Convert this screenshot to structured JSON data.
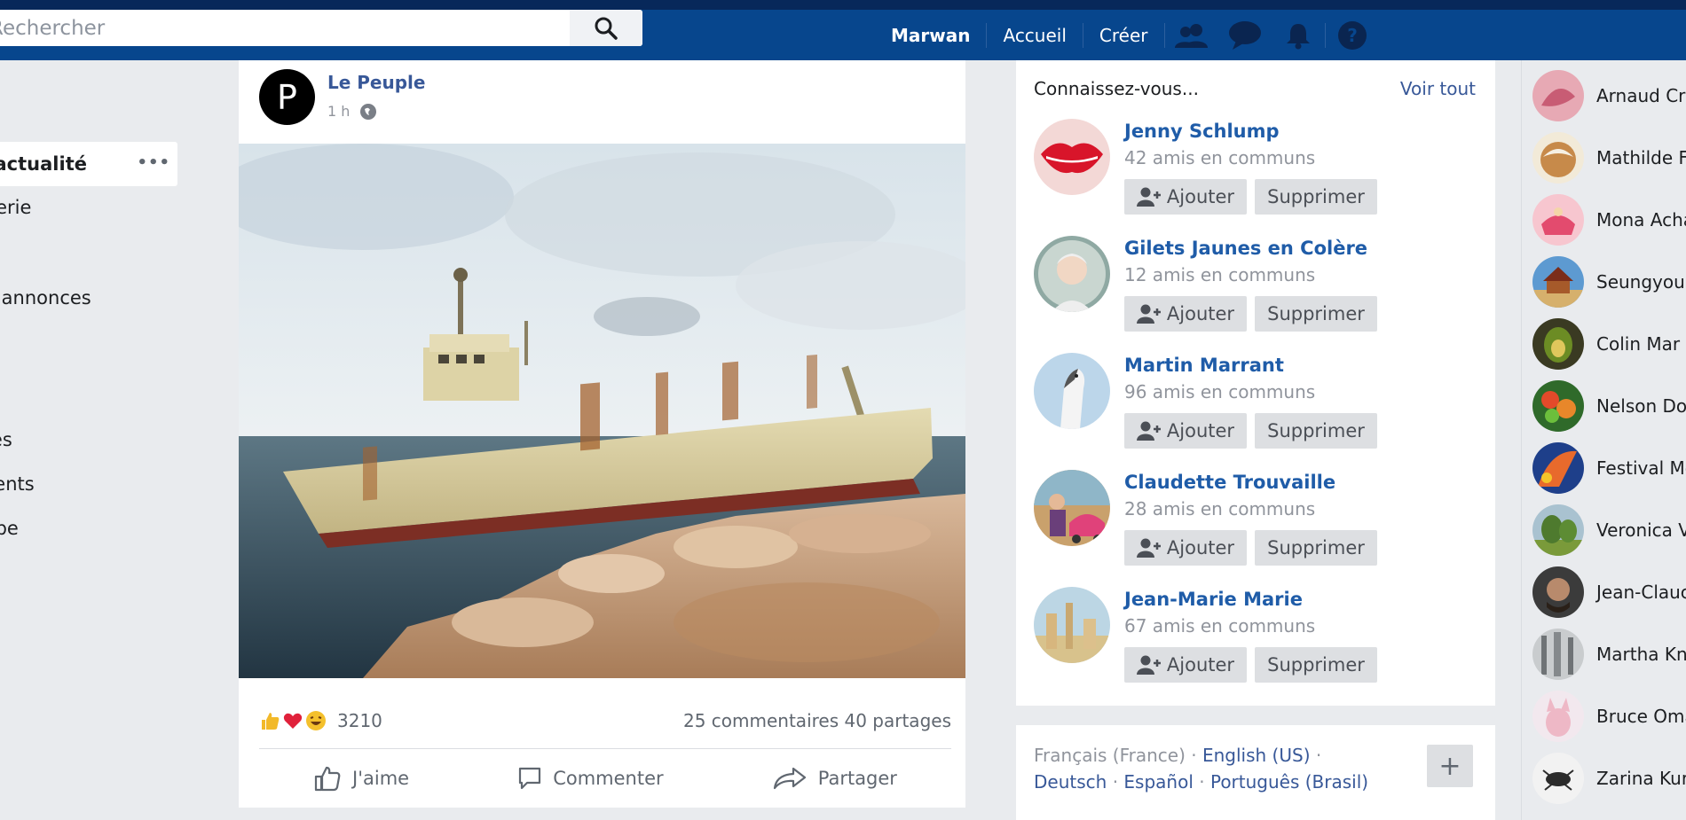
{
  "search": {
    "placeholder": "Rechercher"
  },
  "topnav": {
    "user": "Marwan",
    "home": "Accueil",
    "create": "Créer"
  },
  "left_nav": {
    "items": [
      {
        "label": "Fil d'actualité",
        "active": true
      },
      {
        "label": "Messagerie"
      },
      {
        "label": "Petites annonces"
      },
      {
        "label": "Pages"
      },
      {
        "label": "Événements"
      },
      {
        "label": "Groupe"
      }
    ]
  },
  "post": {
    "avatar_letter": "P",
    "author": "Le Peuple",
    "time": "1 h",
    "reaction_count": "3210",
    "comments_shares": "25 commentaires 40 partages",
    "actions": {
      "like": "J'aime",
      "comment": "Commenter",
      "share": "Partager"
    }
  },
  "suggestions": {
    "title": "Connaissez-vous...",
    "see_all": "Voir tout",
    "add_label": "Ajouter",
    "remove_label": "Supprimer",
    "people": [
      {
        "name": "Jenny Schlump",
        "mutual": "42 amis en communs"
      },
      {
        "name": "Gilets Jaunes en Colère",
        "mutual": "12 amis en communs"
      },
      {
        "name": "Martin Marrant",
        "mutual": "96 amis en communs"
      },
      {
        "name": "Claudette Trouvaille",
        "mutual": "28 amis en communs"
      },
      {
        "name": "Jean-Marie Marie",
        "mutual": "67 amis en communs"
      }
    ]
  },
  "languages": {
    "current": "Français (France)",
    "english": "English (US)",
    "german": "Deutsch",
    "spanish": "Español",
    "portuguese": "Português (Brasil)",
    "more": "+"
  },
  "contacts": [
    {
      "name": "Arnaud Cra"
    },
    {
      "name": "Mathilde F"
    },
    {
      "name": "Mona Acha"
    },
    {
      "name": "Seungyou"
    },
    {
      "name": "Colin Mar"
    },
    {
      "name": "Nelson Do"
    },
    {
      "name": "Festival Mo"
    },
    {
      "name": "Veronica V"
    },
    {
      "name": "Jean-Clauc"
    },
    {
      "name": "Martha Kn"
    },
    {
      "name": "Bruce Oma"
    },
    {
      "name": "Zarina Kur"
    }
  ]
}
